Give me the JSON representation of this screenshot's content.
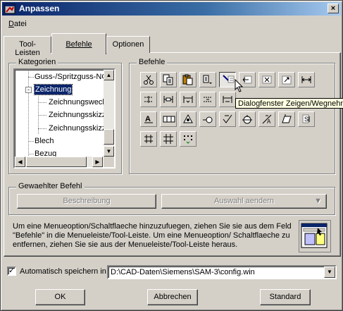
{
  "window": {
    "title": "Anpassen",
    "close_glyph": "×"
  },
  "menubar": {
    "items": [
      {
        "label": "Datei"
      }
    ]
  },
  "tabs": [
    {
      "label": "Tool-Leisten",
      "active": false
    },
    {
      "label": "Befehle",
      "active": true
    },
    {
      "label": "Optionen",
      "active": false
    }
  ],
  "categories": {
    "label": "Kategorien",
    "items": [
      {
        "label": "Guss-/Spritzguss-NC",
        "level": 1,
        "expander": ""
      },
      {
        "label": "Zeichnung",
        "level": 1,
        "expander": "-",
        "selected": true
      },
      {
        "label": "Zeichnungswech",
        "level": 2,
        "expander": ""
      },
      {
        "label": "Zeichnungsskizz",
        "level": 2,
        "expander": ""
      },
      {
        "label": "Zeichnungsskizz",
        "level": 2,
        "expander": ""
      },
      {
        "label": "Blech",
        "level": 1,
        "expander": ""
      },
      {
        "label": "Bezug",
        "level": 1,
        "expander": ""
      }
    ]
  },
  "commands": {
    "label": "Befehle",
    "tooltip": "Dialogfenster Zeigen/Wegnehmen",
    "icons": [
      "scissors-icon",
      "copy-icon",
      "paste-icon",
      "dropdown-tool-icon",
      "dialog-toggle-icon",
      "arrow-left-box-icon",
      "cross-box-icon",
      "arrow-up-right-box-icon",
      "dimension-h-icon",
      "align-dim-icon",
      "dim-bracket-icon",
      "dim-bracket-small-icon",
      "align-dim-2-icon",
      "dim-bracket-2-icon",
      "hidden-1",
      "hidden-2",
      "hidden-3",
      "hidden-4",
      "text-a-icon",
      "tolerance-box-icon",
      "datum-triangle-icon",
      "arrow-circle-icon",
      "circle-target-icon",
      "check-mark-icon",
      "circle-mark-icon",
      "slash-a-icon",
      "parallelogram-icon",
      "text-s-icon",
      "grid-cross-icon",
      "grid-hash-icon",
      "grid-dots-icon"
    ]
  },
  "selected_command": {
    "label": "Gewaehlter Befehl",
    "description_button": "Beschreibung",
    "modify_button": "Auswahl aendern"
  },
  "help_text": "Um eine Menueoption/Schaltflaeche hinzuzufuegen, ziehen Sie sie aus dem Feld \"Befehle\" in die Menueleiste/Tool-Leiste. Um eine Menueoption/ Schaltflaeche zu entfernen, ziehen Sie sie aus der Menueleiste/Tool-Leiste heraus.",
  "autosave": {
    "checked": true,
    "label": "Automatisch speichern in",
    "path": "D:\\CAD-Daten\\Siemens\\SAM-3\\config.win"
  },
  "buttons": {
    "ok": "OK",
    "cancel": "Abbrechen",
    "default": "Standard"
  },
  "colors": {
    "title_start": "#0a246a",
    "title_end": "#a6caf0",
    "face": "#d4d0c8",
    "selection": "#0a246a",
    "tooltip_bg": "#ffffe1"
  }
}
